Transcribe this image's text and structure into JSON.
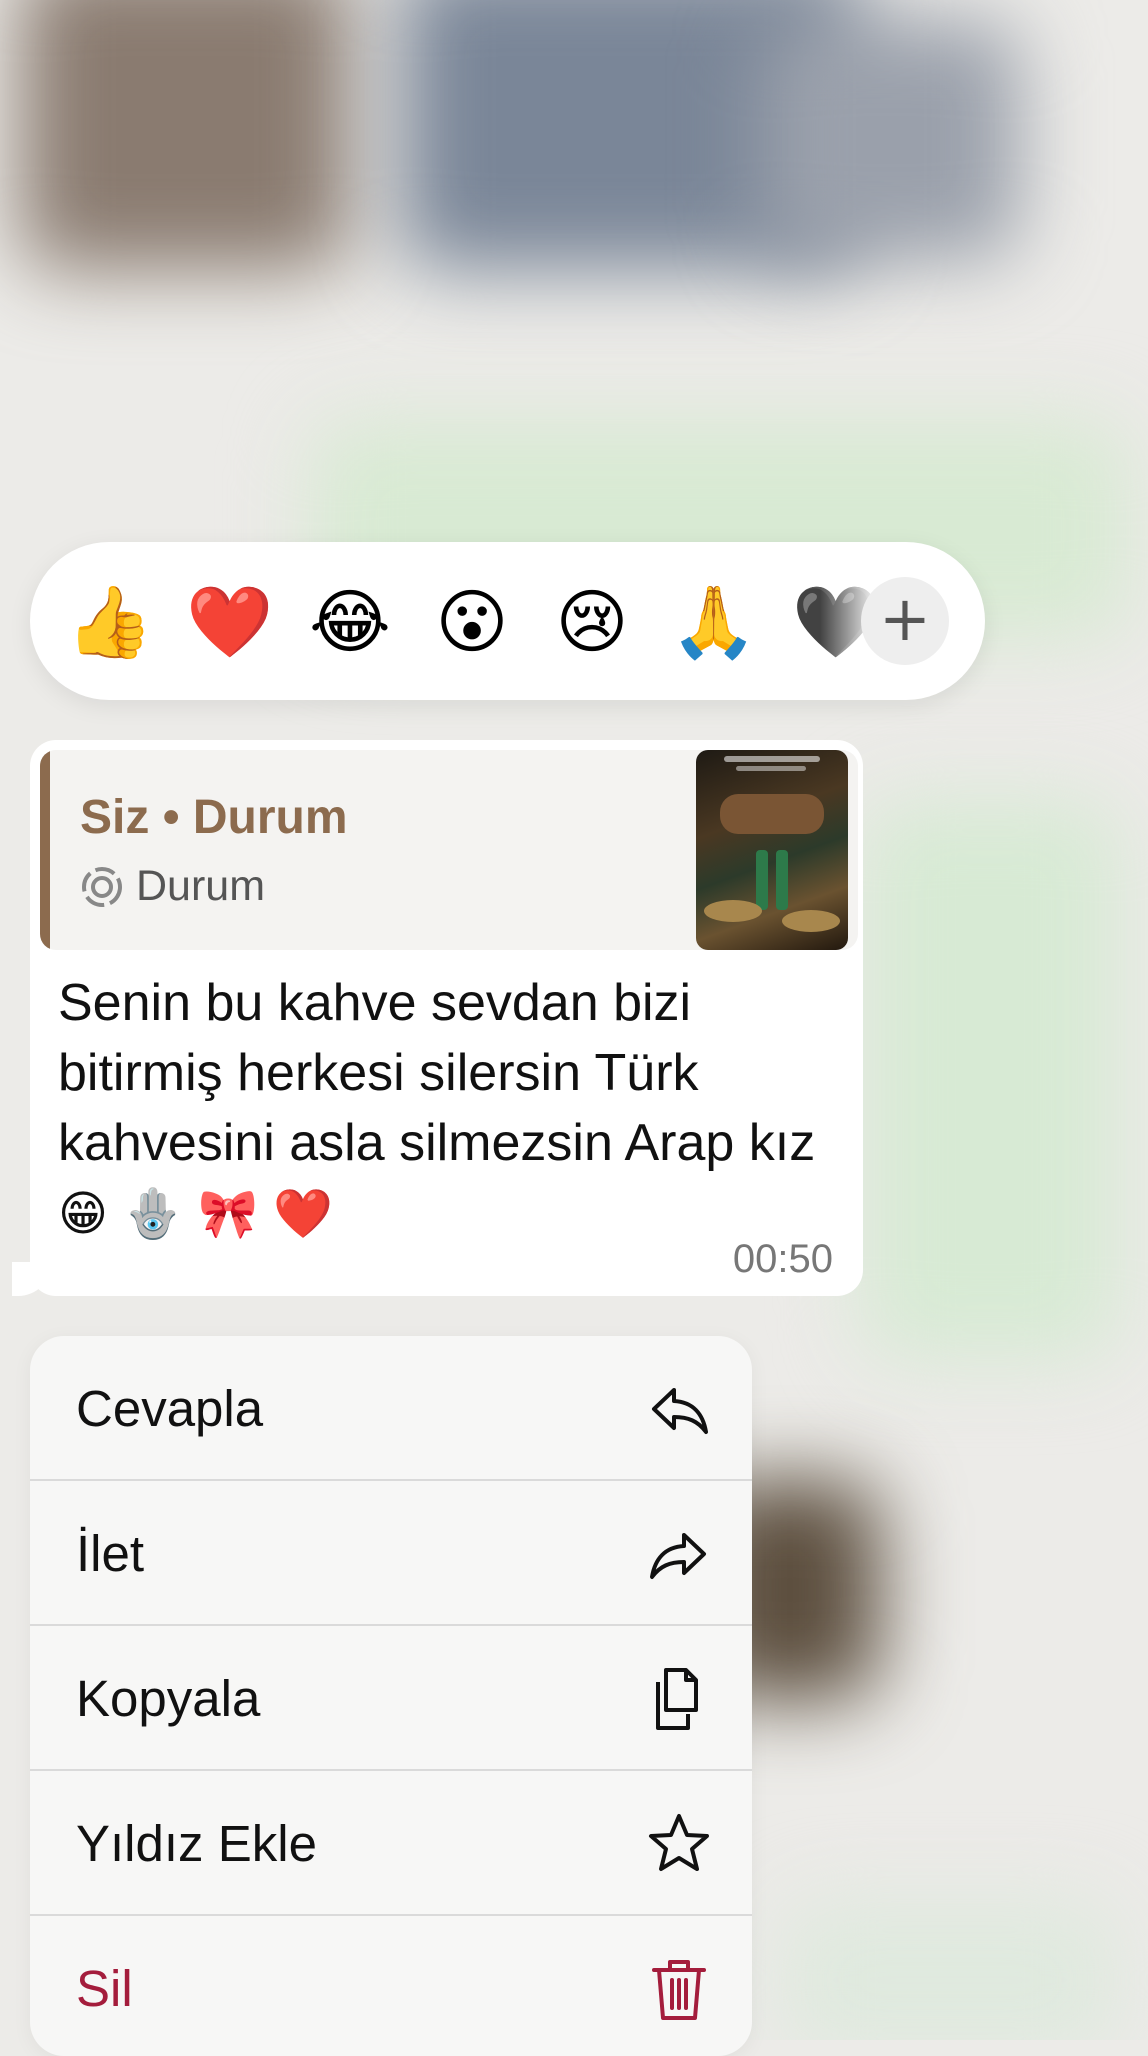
{
  "reactions": {
    "emojis": [
      {
        "glyph": "👍",
        "name": "thumbs-up"
      },
      {
        "glyph": "❤️",
        "name": "red-heart"
      },
      {
        "glyph": "😂",
        "name": "joy"
      },
      {
        "glyph": "😮",
        "name": "open-mouth"
      },
      {
        "glyph": "😢",
        "name": "cry"
      },
      {
        "glyph": "🙏",
        "name": "pray"
      },
      {
        "glyph": "🖤",
        "name": "black-heart"
      }
    ],
    "more_label": "+"
  },
  "message": {
    "quote": {
      "title": "Siz • Durum",
      "subtitle": "Durum",
      "accent_color": "#8c6b4e"
    },
    "text": "Senin bu kahve sevdan bizi bitirmiş herkesi silersin Türk kahvesini asla silmezsin Arap kız ",
    "emojis": "😁 🪬 🎀 ❤️",
    "time": "00:50"
  },
  "menu": {
    "items": [
      {
        "label": "Cevapla",
        "icon": "reply-icon"
      },
      {
        "label": "İlet",
        "icon": "forward-icon"
      },
      {
        "label": "Kopyala",
        "icon": "copy-icon"
      },
      {
        "label": "Yıldız Ekle",
        "icon": "star-icon"
      },
      {
        "label": "Sil",
        "icon": "trash-icon",
        "danger_color": "#a41d3c"
      }
    ]
  }
}
